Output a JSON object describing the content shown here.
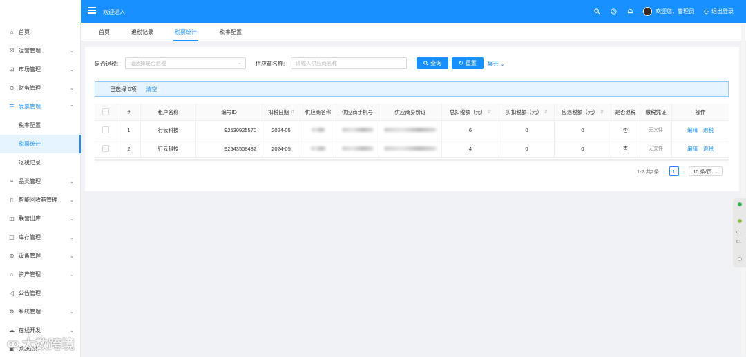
{
  "header": {
    "welcome": "欢迎进入",
    "user_greeting": "欢迎您，管理员",
    "logout": "退出登录"
  },
  "sidebar": {
    "items": [
      {
        "label": "首页",
        "icon": "home-icon"
      },
      {
        "label": "运营管理",
        "icon": "operations-icon"
      },
      {
        "label": "市场管理",
        "icon": "market-icon"
      },
      {
        "label": "财务管理",
        "icon": "finance-icon"
      },
      {
        "label": "发票管理",
        "icon": "invoice-icon"
      },
      {
        "label": "税率配置"
      },
      {
        "label": "税票统计"
      },
      {
        "label": "退税记录"
      },
      {
        "label": "品类管理",
        "icon": "category-icon"
      },
      {
        "label": "智能回收箱管理",
        "icon": "recycle-bin-icon"
      },
      {
        "label": "联营出库",
        "icon": "outbound-icon"
      },
      {
        "label": "库存管理",
        "icon": "inventory-icon"
      },
      {
        "label": "设备管理",
        "icon": "device-icon"
      },
      {
        "label": "资产管理",
        "icon": "asset-icon"
      },
      {
        "label": "公告管理",
        "icon": "announcement-icon"
      },
      {
        "label": "系统管理",
        "icon": "system-icon"
      },
      {
        "label": "在线开发",
        "icon": "dev-icon"
      },
      {
        "label": "系统监控",
        "icon": "monitor-icon"
      }
    ]
  },
  "tabs": [
    "首页",
    "退税记录",
    "税票统计",
    "税率配置"
  ],
  "filters": {
    "refund_label": "是否退税:",
    "refund_placeholder": "请选择是否退税",
    "supplier_label": "供应商名称:",
    "supplier_placeholder": "请输入供应商名称",
    "search_btn": "查询",
    "reset_btn": "重置",
    "expand": "展开"
  },
  "alert": {
    "selected": "已选择 0项",
    "clear": "清空"
  },
  "table": {
    "headers": [
      "#",
      "租户名称",
      "编号ID",
      "扣税日期",
      "供应商名称",
      "供应商手机号",
      "供应商身份证",
      "总扣税额（元）",
      "实扣税额（元）",
      "应退税额（元）",
      "是否退税",
      "缴税凭证",
      "操作"
    ],
    "rows": [
      {
        "idx": "1",
        "tenant": "行云科技",
        "id": "92530925570",
        "date": "2024-05",
        "total": "6",
        "actual": "0",
        "due": "0",
        "refunded": "否",
        "voucher": "无文件",
        "edit": "编辑",
        "refund": "退税"
      },
      {
        "idx": "2",
        "tenant": "行云科技",
        "id": "92543508482",
        "date": "2024-05",
        "total": "4",
        "actual": "0",
        "due": "0",
        "refunded": "否",
        "voucher": "无文件",
        "edit": "编辑",
        "refund": "退税"
      }
    ]
  },
  "pagination": {
    "total": "1-2 共2条",
    "page": "1",
    "size": "10 条/页"
  },
  "float_panel": {
    "t1": "0.1",
    "t2": "0.1"
  },
  "watermark": "大数跨境",
  "colors": {
    "primary": "#1890ff",
    "alert_bg": "#e6f4ff"
  }
}
